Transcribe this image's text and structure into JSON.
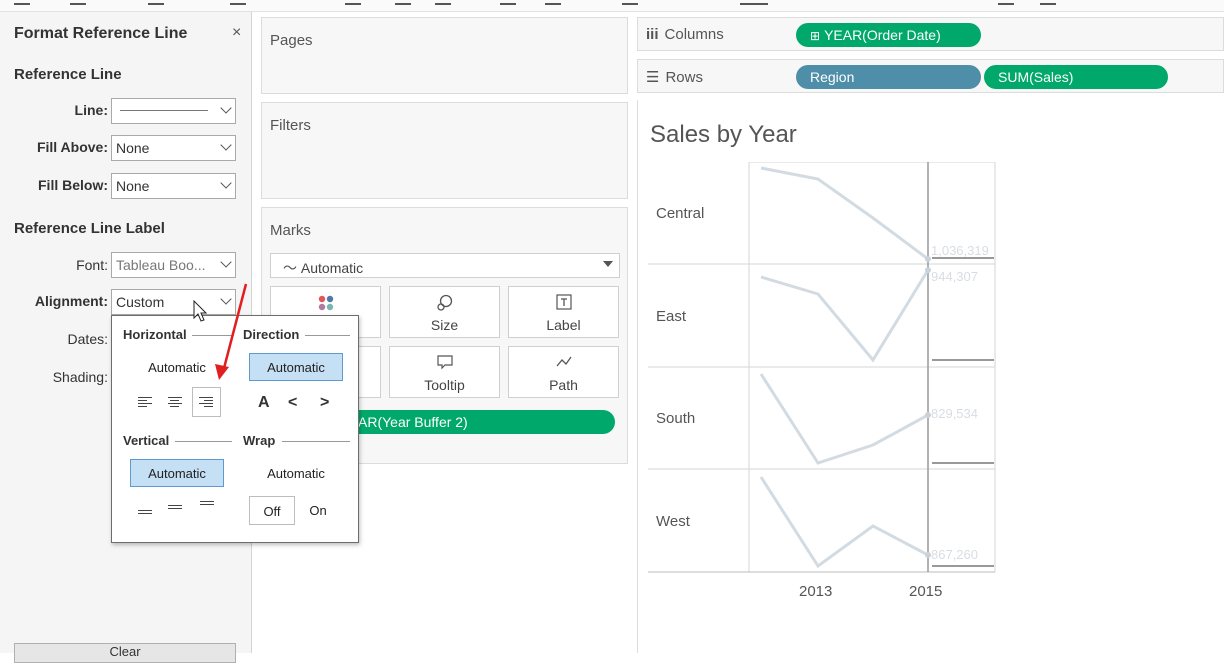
{
  "left_panel": {
    "title": "Format Reference Line",
    "close": "×",
    "sections": {
      "reference_line": "Reference Line",
      "reference_line_label": "Reference Line Label"
    },
    "fields": {
      "line_label": "Line:",
      "fill_above_label": "Fill Above:",
      "fill_above_value": "None",
      "fill_below_label": "Fill Below:",
      "fill_below_value": "None",
      "font_label": "Font:",
      "font_value": "Tableau Boo...",
      "alignment_label": "Alignment:",
      "alignment_value": "Custom",
      "dates_label": "Dates:",
      "shading_label": "Shading:"
    },
    "clear_button": "Clear"
  },
  "shelves": {
    "pages": "Pages",
    "filters": "Filters",
    "marks": {
      "title": "Marks",
      "type_value": "Automatic",
      "buttons": {
        "size": "Size",
        "label": "Label",
        "tooltip": "Tooltip",
        "path": "Path"
      },
      "pill": "AR(Year Buffer 2)"
    },
    "columns": {
      "label": "Columns",
      "pills": [
        "YEAR(Order Date)"
      ]
    },
    "rows": {
      "label": "Rows",
      "pills": [
        "Region",
        "SUM(Sales)"
      ]
    }
  },
  "view": {
    "title": "Sales by Year",
    "regions": [
      "Central",
      "East",
      "South",
      "West"
    ],
    "years": [
      "2013",
      "2015"
    ],
    "value_labels": [
      "1,036,319",
      "944,307",
      "829,534",
      "867,260"
    ]
  },
  "popup": {
    "horizontal": "Horizontal",
    "direction": "Direction",
    "horizontal_value": "Automatic",
    "direction_value": "Automatic",
    "vertical": "Vertical",
    "wrap": "Wrap",
    "vertical_value": "Automatic",
    "wrap_value": "Automatic",
    "wrap_off": "Off",
    "wrap_on": "On",
    "direction_glyphs": [
      "A",
      "<",
      ">"
    ]
  },
  "colors": {
    "pill_green": "#00a86b",
    "pill_blue": "#4e8ea9",
    "line_color": "#d3dbe2",
    "annotation_arrow": "#e02020",
    "selected_option": "#c5dff5"
  }
}
